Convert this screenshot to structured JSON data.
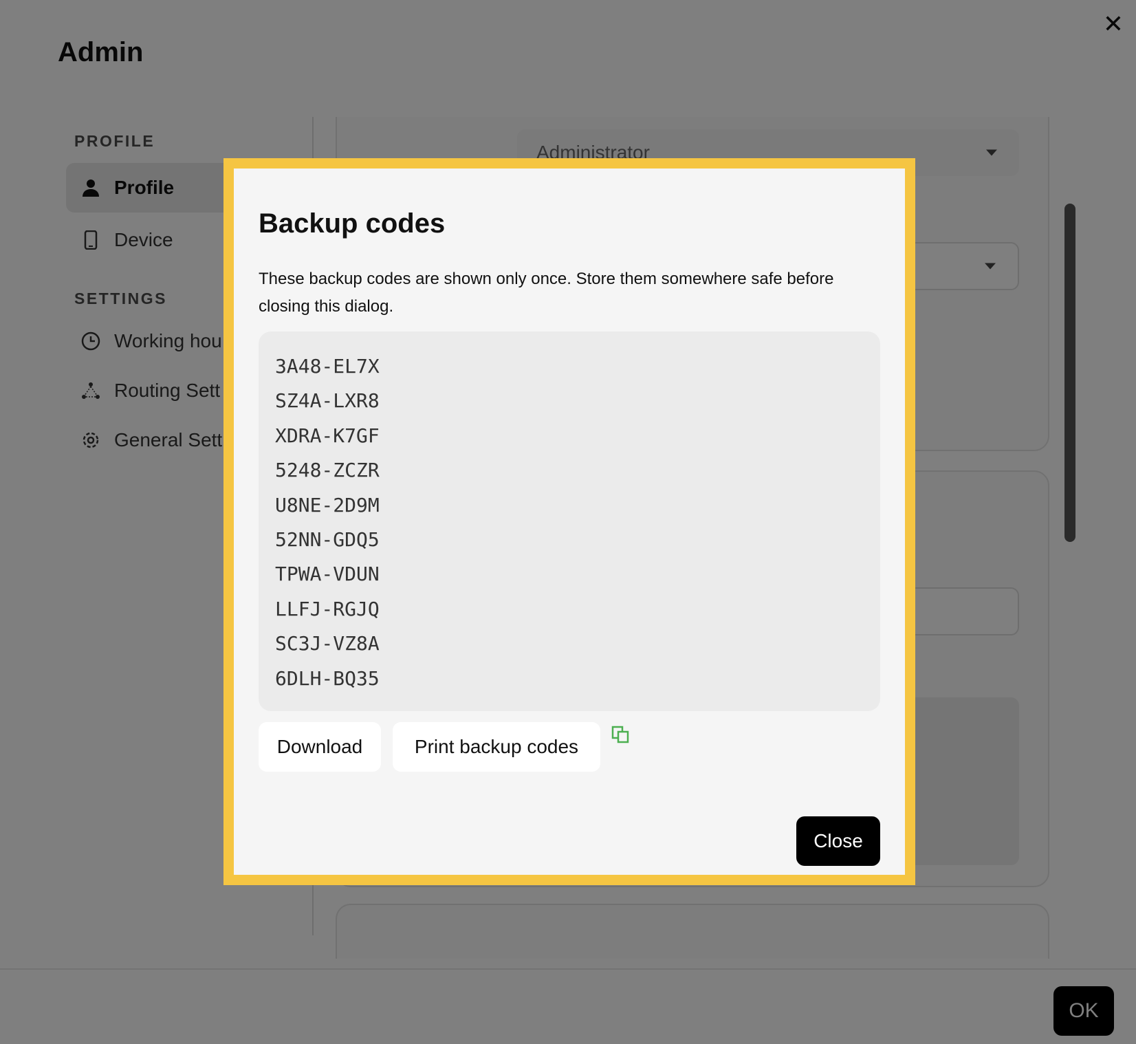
{
  "page": {
    "title": "Admin",
    "sidebar": {
      "sections": [
        {
          "label": "PROFILE",
          "items": [
            {
              "label": "Profile",
              "icon": "user-icon",
              "active": true
            },
            {
              "label": "Device",
              "icon": "phone-icon"
            }
          ]
        },
        {
          "label": "SETTINGS",
          "items": [
            {
              "label": "Working hou",
              "icon": "clock-icon"
            },
            {
              "label": "Routing Sett",
              "icon": "routing-icon"
            },
            {
              "label": "General Sett",
              "icon": "gear-icon"
            }
          ]
        }
      ]
    },
    "role_select": {
      "value": "Administrator"
    },
    "ok_label": "OK"
  },
  "modal": {
    "title": "Backup codes",
    "description": "These backup codes are shown only once. Store them somewhere safe before closing this dialog.",
    "codes": [
      "3A48-EL7X",
      "SZ4A-LXR8",
      "XDRA-K7GF",
      "5248-ZCZR",
      "U8NE-2D9M",
      "52NN-GDQ5",
      "TPWA-VDUN",
      "LLFJ-RGJQ",
      "SC3J-VZ8A",
      "6DLH-BQ35"
    ],
    "download_label": "Download",
    "print_label": "Print backup codes",
    "close_label": "Close",
    "frame_color": "#F5C542",
    "copy_icon_color": "#4CAF50"
  }
}
